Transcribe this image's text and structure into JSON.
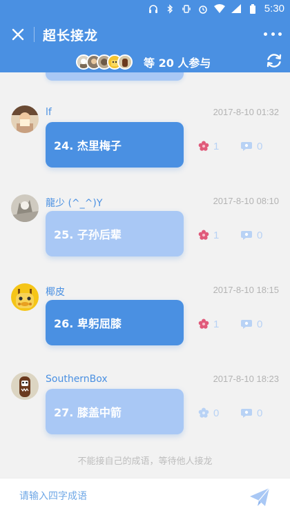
{
  "status_bar": {
    "time": "5:30"
  },
  "header": {
    "title": "超长接龙",
    "participants_text": "等 20 人参与"
  },
  "colors": {
    "primary": "#4a90e2",
    "bubble_light": "#a9c8f5",
    "flower": "#e05a7a"
  },
  "entries": [
    {
      "username": "lf",
      "time": "2017-8-10 01:32",
      "idiom": "24. 杰里梅子",
      "flowers": "1",
      "comments": "0"
    },
    {
      "username": "龍少 (^_^)Y",
      "time": "2017-8-10 08:10",
      "idiom": "25. 子孙后辈",
      "flowers": "1",
      "comments": "0"
    },
    {
      "username": "椰皮",
      "time": "2017-8-10 18:15",
      "idiom": "26. 卑躬屈膝",
      "flowers": "1",
      "comments": "0"
    },
    {
      "username": "SouthernBox",
      "time": "2017-8-10 18:23",
      "idiom": "27. 膝盖中箭",
      "flowers": "0",
      "comments": "0"
    }
  ],
  "hint": "不能接自己的成语，等待他人接龙",
  "input": {
    "placeholder": "请输入四字成语"
  }
}
